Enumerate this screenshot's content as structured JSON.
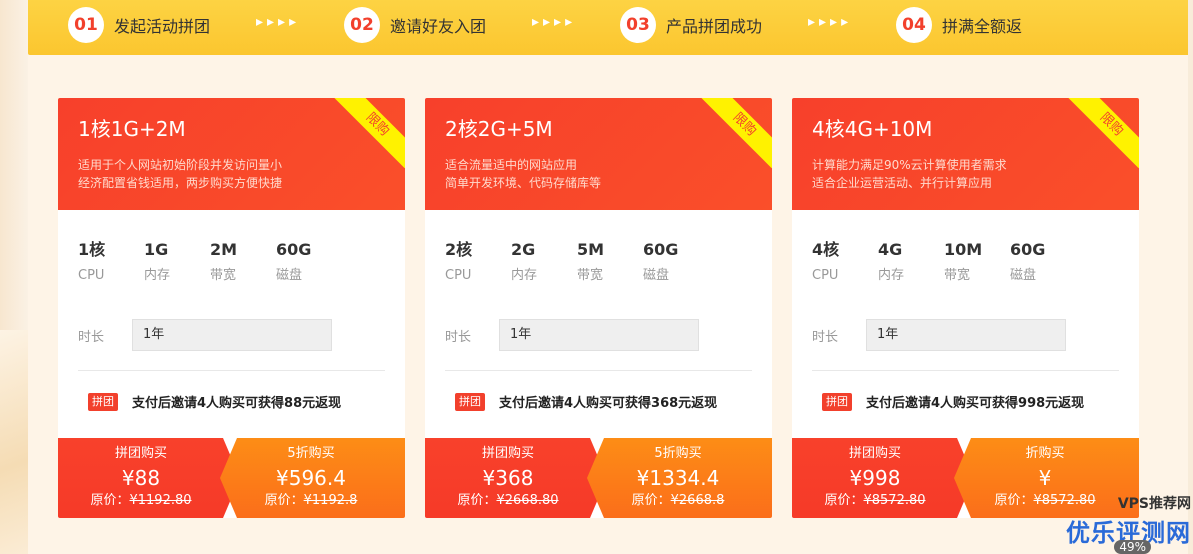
{
  "steps": [
    {
      "num": "01",
      "label": "发起活动拼团"
    },
    {
      "num": "02",
      "label": "邀请好友入团"
    },
    {
      "num": "03",
      "label": "产品拼团成功"
    },
    {
      "num": "04",
      "label": "拼满全额返"
    }
  ],
  "step_arrows": "▸▸▸▸",
  "spec_labels": {
    "cpu": "CPU",
    "mem": "内存",
    "bw": "带宽",
    "disk": "磁盘"
  },
  "duration_label": "时长",
  "group_tag": "拼团",
  "ribbon_text": "限购",
  "original_label": "原价：",
  "cards": [
    {
      "title": "1核1G+2M",
      "desc1": "适用于个人网站初始阶段并发访问量小",
      "desc2": "经济配置省钱适用，两步购买方便快捷",
      "cpu": "1核",
      "mem": "1G",
      "bw": "2M",
      "disk": "60G",
      "duration": "1年",
      "group_text": "支付后邀请4人购买可获得88元返现",
      "left_label": "拼团购买",
      "left_price": "¥88",
      "left_orig": "¥1192.80",
      "right_label": "5折购买",
      "right_price": "¥596.4",
      "right_orig": "¥1192.8"
    },
    {
      "title": "2核2G+5M",
      "desc1": "适合流量适中的网站应用",
      "desc2": "简单开发环境、代码存储库等",
      "cpu": "2核",
      "mem": "2G",
      "bw": "5M",
      "disk": "60G",
      "duration": "1年",
      "group_text": "支付后邀请4人购买可获得368元返现",
      "left_label": "拼团购买",
      "left_price": "¥368",
      "left_orig": "¥2668.80",
      "right_label": "5折购买",
      "right_price": "¥1334.4",
      "right_orig": "¥2668.8"
    },
    {
      "title": "4核4G+10M",
      "desc1": "计算能力满足90%云计算使用者需求",
      "desc2": "适合企业运营活动、并行计算应用",
      "cpu": "4核",
      "mem": "4G",
      "bw": "10M",
      "disk": "60G",
      "duration": "1年",
      "group_text": "支付后邀请4人购买可获得998元返现",
      "left_label": "拼团购买",
      "left_price": "¥998",
      "left_orig": "¥8572.80",
      "right_label": "折购买",
      "right_price": "¥",
      "right_orig": "¥8572.80"
    }
  ],
  "watermark": {
    "top": "VPS推荐网",
    "main": "优乐评测网",
    "badge": "49%"
  }
}
